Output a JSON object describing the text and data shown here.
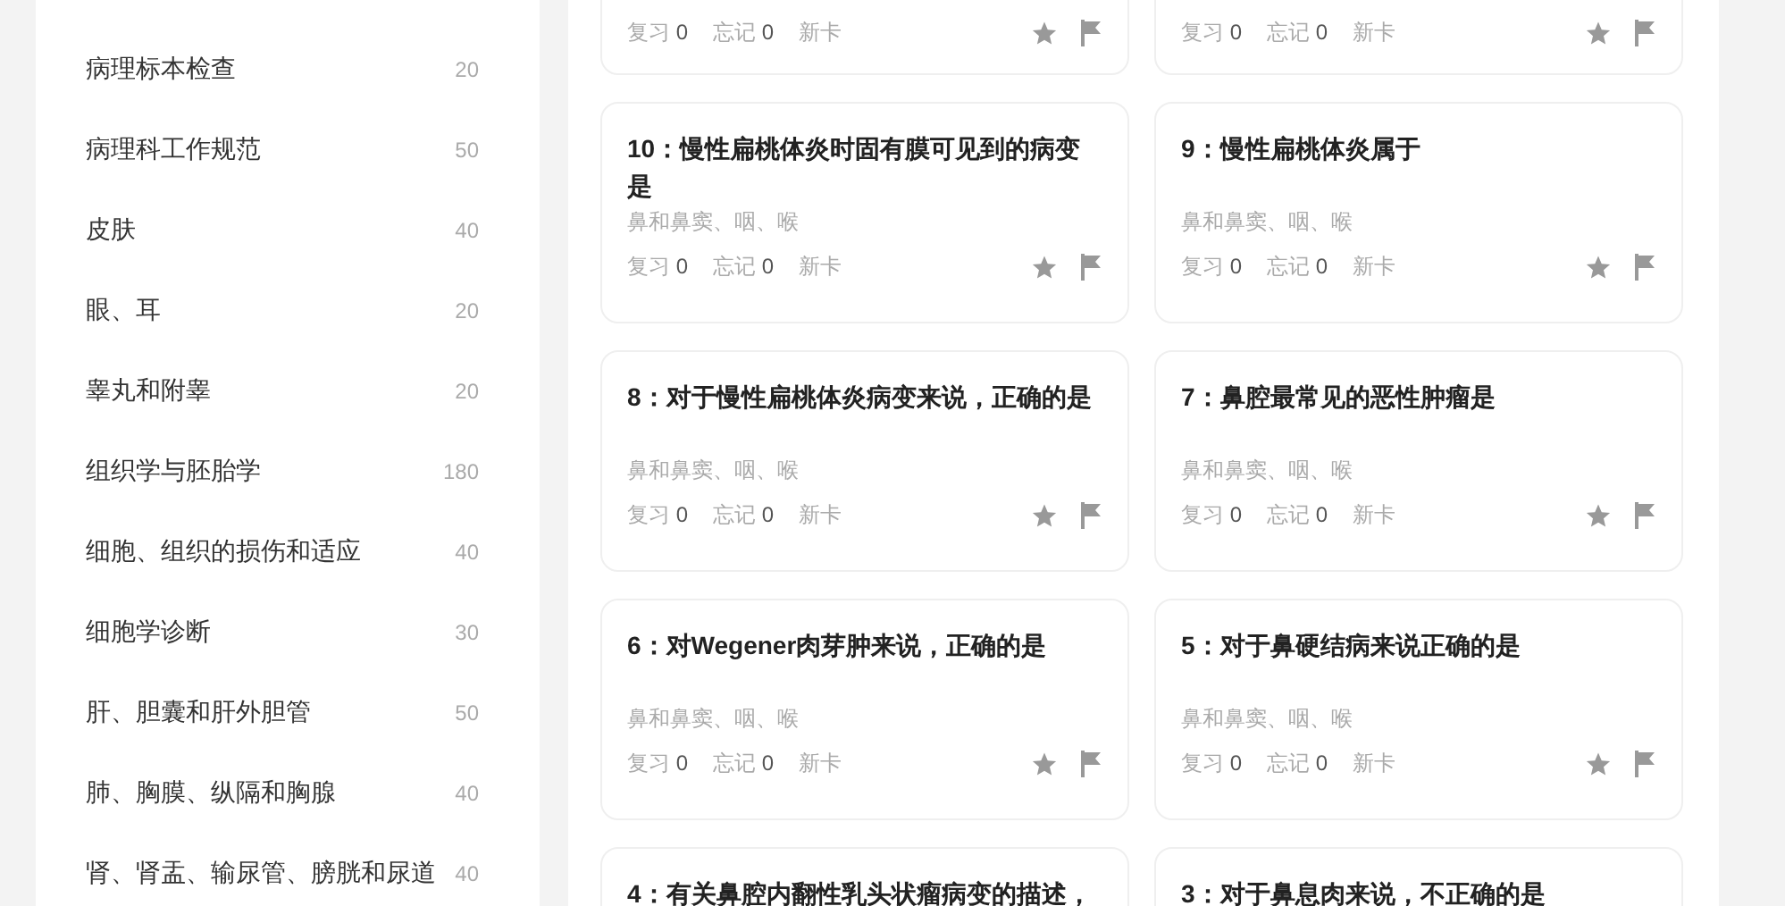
{
  "sidebar": {
    "items": [
      {
        "label": "病理标本检查",
        "count": "20"
      },
      {
        "label": "病理科工作规范",
        "count": "50"
      },
      {
        "label": "皮肤",
        "count": "40"
      },
      {
        "label": "眼、耳",
        "count": "20"
      },
      {
        "label": "睾丸和附睾",
        "count": "20"
      },
      {
        "label": "组织学与胚胎学",
        "count": "180"
      },
      {
        "label": "细胞、组织的损伤和适应",
        "count": "40"
      },
      {
        "label": "细胞学诊断",
        "count": "30"
      },
      {
        "label": "肝、胆囊和肝外胆管",
        "count": "50"
      },
      {
        "label": "肺、胸膜、纵隔和胸腺",
        "count": "40"
      },
      {
        "label": "肾、肾盂、输尿管、膀胱和尿道",
        "count": "40"
      }
    ]
  },
  "cards": [
    {
      "kind": "partial",
      "stats": [
        {
          "label": "复习",
          "value": "0"
        },
        {
          "label": "忘记",
          "value": "0"
        },
        {
          "label": "新卡"
        }
      ]
    },
    {
      "kind": "partial",
      "stats": [
        {
          "label": "复习",
          "value": "0"
        },
        {
          "label": "忘记",
          "value": "0"
        },
        {
          "label": "新卡"
        }
      ]
    },
    {
      "kind": "full",
      "title": "10：慢性扁桃体炎时固有膜可见到的病变是",
      "tag": "鼻和鼻窦、咽、喉",
      "stats": [
        {
          "label": "复习",
          "value": "0"
        },
        {
          "label": "忘记",
          "value": "0"
        },
        {
          "label": "新卡"
        }
      ]
    },
    {
      "kind": "full",
      "title": "9：慢性扁桃体炎属于",
      "tag": "鼻和鼻窦、咽、喉",
      "stats": [
        {
          "label": "复习",
          "value": "0"
        },
        {
          "label": "忘记",
          "value": "0"
        },
        {
          "label": "新卡"
        }
      ]
    },
    {
      "kind": "full",
      "title": "8：对于慢性扁桃体炎病变来说，正确的是",
      "tag": "鼻和鼻窦、咽、喉",
      "stats": [
        {
          "label": "复习",
          "value": "0"
        },
        {
          "label": "忘记",
          "value": "0"
        },
        {
          "label": "新卡"
        }
      ]
    },
    {
      "kind": "full",
      "title": "7：鼻腔最常见的恶性肿瘤是",
      "tag": "鼻和鼻窦、咽、喉",
      "stats": [
        {
          "label": "复习",
          "value": "0"
        },
        {
          "label": "忘记",
          "value": "0"
        },
        {
          "label": "新卡"
        }
      ]
    },
    {
      "kind": "full",
      "title": "6：对Wegener肉芽肿来说，正确的是",
      "tag": "鼻和鼻窦、咽、喉",
      "stats": [
        {
          "label": "复习",
          "value": "0"
        },
        {
          "label": "忘记",
          "value": "0"
        },
        {
          "label": "新卡"
        }
      ]
    },
    {
      "kind": "full",
      "title": "5：对于鼻硬结病来说正确的是",
      "tag": "鼻和鼻窦、咽、喉",
      "stats": [
        {
          "label": "复习",
          "value": "0"
        },
        {
          "label": "忘记",
          "value": "0"
        },
        {
          "label": "新卡"
        }
      ]
    },
    {
      "kind": "title_only",
      "title": "4：有关鼻腔内翻性乳头状瘤病变的描述，"
    },
    {
      "kind": "title_only",
      "title": "3：对于鼻息肉来说，不正确的是"
    }
  ]
}
